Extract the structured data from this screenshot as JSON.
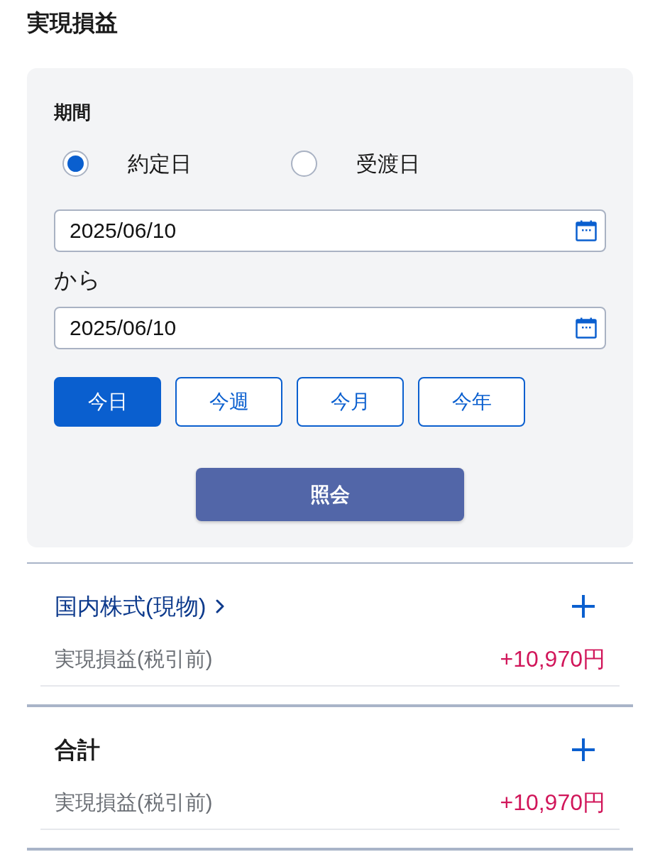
{
  "title": "実現損益",
  "filter": {
    "period_label": "期間",
    "date_type_options": [
      {
        "label": "約定日",
        "selected": true
      },
      {
        "label": "受渡日",
        "selected": false
      }
    ],
    "start_date": {
      "value": "2025/06/10"
    },
    "range_connector": "から",
    "end_date": {
      "value": "2025/06/10"
    },
    "quick_ranges": [
      {
        "label": "今日",
        "selected": true
      },
      {
        "label": "今週",
        "selected": false
      },
      {
        "label": "今月",
        "selected": false
      },
      {
        "label": "今年",
        "selected": false
      }
    ],
    "submit_button": "照会"
  },
  "sections": [
    {
      "kind": "link",
      "heading": "国内株式(現物)",
      "expanded": false,
      "rows": [
        {
          "label": "実現損益(税引前)",
          "value": "+10,970円"
        }
      ]
    },
    {
      "kind": "plain",
      "heading": "合計",
      "expanded": false,
      "rows": [
        {
          "label": "実現損益(税引前)",
          "value": "+10,970円"
        }
      ]
    }
  ]
}
